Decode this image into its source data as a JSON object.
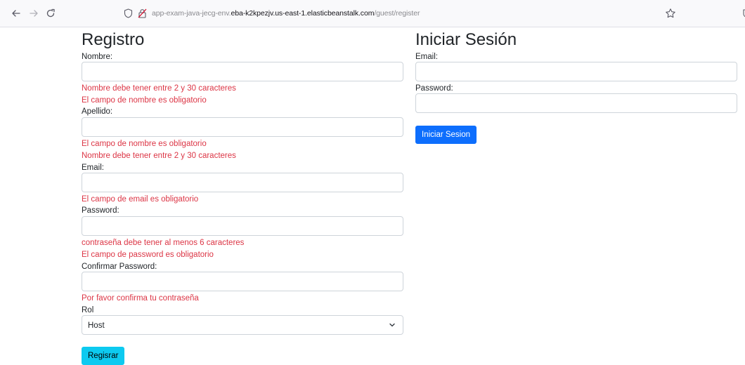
{
  "browser": {
    "url_prefix": "app-exam-java-jecg-env.",
    "url_host": "eba-k2kpezjv.us-east-1.elasticbeanstalk.com",
    "url_path": "/guest/register"
  },
  "register": {
    "title": "Registro",
    "nombre": {
      "label": "Nombre:",
      "value": "",
      "errors": [
        "Nombre debe tener entre 2 y 30 caracteres",
        "El campo de nombre es obligatorio"
      ]
    },
    "apellido": {
      "label": "Apellido:",
      "value": "",
      "errors": [
        "El campo de nombre es obligatorio",
        "Nombre debe tener entre 2 y 30 caracteres"
      ]
    },
    "email": {
      "label": "Email:",
      "value": "",
      "errors": [
        "El campo de email es obligatorio"
      ]
    },
    "password": {
      "label": "Password:",
      "value": "",
      "errors": [
        "contraseña debe tener al menos 6 caracteres",
        "El campo de password es obligatorio"
      ]
    },
    "confirm": {
      "label": "Confirmar Password:",
      "value": "",
      "errors": [
        "Por favor confirma tu contraseña"
      ]
    },
    "rol": {
      "label": "Rol",
      "selected": "Host"
    },
    "submit_label": "Regisrar"
  },
  "login": {
    "title": "Iniciar Sesión",
    "email_label": "Email:",
    "email_value": "",
    "password_label": "Password:",
    "password_value": "",
    "submit_label": "Iniciar Sesion"
  },
  "colors": {
    "error": "#dc3545",
    "info_button": "#0dcaf0",
    "primary_button": "#0d6efd"
  },
  "icons": [
    "arrow-left-icon",
    "arrow-right-icon",
    "reload-icon",
    "shield-icon",
    "lock-icon",
    "star-icon",
    "chevron-down-icon"
  ]
}
